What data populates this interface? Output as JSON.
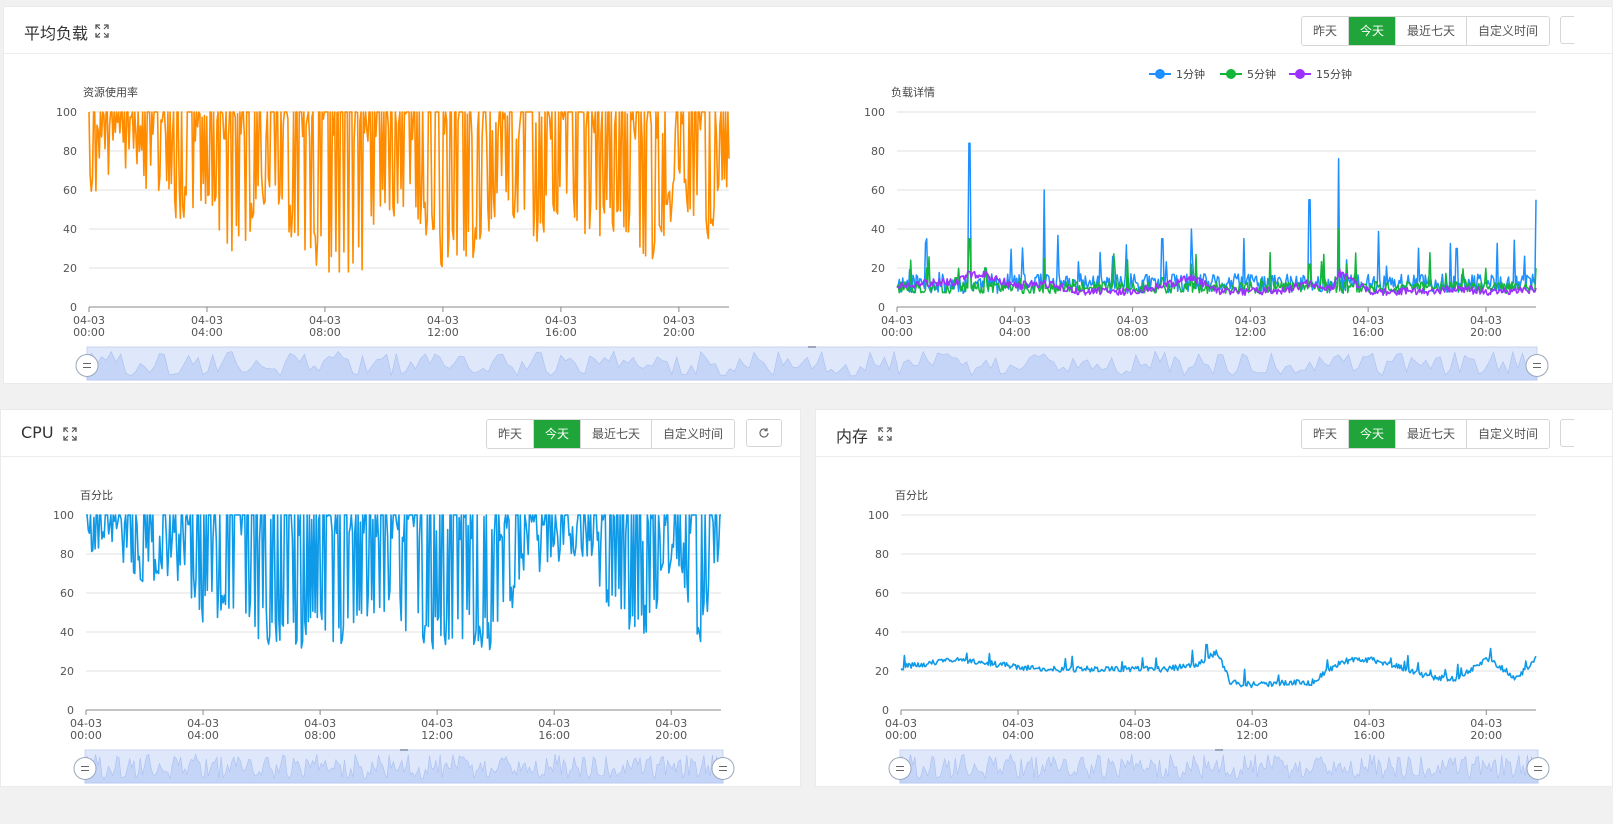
{
  "load_panel": {
    "title": "平均负载",
    "buttons": [
      "昨天",
      "今天",
      "最近七天",
      "自定义时间"
    ],
    "active_button": "今天",
    "left_chart_ylabel": "资源使用率",
    "right_chart_ylabel": "负载详情",
    "legend": [
      "1分钟",
      "5分钟",
      "15分钟"
    ]
  },
  "cpu_panel": {
    "title": "CPU",
    "buttons": [
      "昨天",
      "今天",
      "最近七天",
      "自定义时间"
    ],
    "active_button": "今天",
    "ylabel": "百分比"
  },
  "memory_panel": {
    "title": "内存",
    "buttons": [
      "昨天",
      "今天",
      "最近七天",
      "自定义时间"
    ],
    "active_button": "今天",
    "ylabel": "百分比"
  },
  "colors": {
    "accent_green": "#20a53a",
    "load_usage": "#ff8c00",
    "load_1min": "#1e90ff",
    "load_5min": "#13b53b",
    "load_15min": "#9b30ff",
    "cpu": "#0f9ae8",
    "memory": "#0f9ae8",
    "zoom_fill": "#d4e0fb"
  },
  "icons": {
    "expand": "expand-arrows-icon",
    "refresh": "refresh-icon",
    "zoom_handle": "zoom-handle-icon"
  },
  "chart_data": [
    {
      "id": "load_usage",
      "type": "line",
      "ylabel": "资源使用率",
      "ylim": [
        0,
        100
      ],
      "yticks": [
        0,
        20,
        40,
        60,
        80,
        100
      ],
      "xticks": [
        "04-03\n00:00",
        "04-03\n04:00",
        "04-03\n08:00",
        "04-03\n12:00",
        "04-03\n16:00",
        "04-03\n20:00"
      ],
      "x_hours": [
        0,
        1,
        2,
        3,
        4,
        5,
        6,
        7,
        8,
        9,
        10,
        11,
        12,
        13,
        14,
        15,
        16,
        17,
        18,
        19,
        20,
        21,
        21.7
      ],
      "series": [
        {
          "values": [
            65,
            85,
            70,
            55,
            60,
            35,
            65,
            40,
            28,
            20,
            55,
            60,
            30,
            35,
            60,
            40,
            60,
            45,
            50,
            25,
            65,
            45,
            75
          ]
        }
      ]
    },
    {
      "id": "load_detail",
      "type": "line",
      "ylabel": "负载详情",
      "ylim": [
        0,
        100
      ],
      "yticks": [
        0,
        20,
        40,
        60,
        80,
        100
      ],
      "xticks": [
        "04-03\n00:00",
        "04-03\n04:00",
        "04-03\n08:00",
        "04-03\n12:00",
        "04-03\n16:00",
        "04-03\n20:00"
      ],
      "x_hours": [
        0,
        1,
        2,
        2.45,
        3,
        4,
        5,
        5.8,
        6,
        7,
        8,
        9,
        10,
        11,
        12,
        13,
        14,
        14.8,
        15,
        16,
        17,
        18,
        19,
        20,
        21,
        21.7
      ],
      "legend_position": "top-center",
      "series": [
        {
          "name": "1分钟",
          "values": [
            10,
            35,
            15,
            84,
            20,
            12,
            60,
            10,
            10,
            8,
            10,
            35,
            40,
            10,
            10,
            10,
            55,
            10,
            76,
            8,
            10,
            12,
            30,
            8,
            10,
            55
          ]
        },
        {
          "name": "5分钟",
          "values": [
            10,
            20,
            15,
            35,
            20,
            12,
            25,
            10,
            10,
            8,
            10,
            15,
            22,
            10,
            10,
            10,
            22,
            10,
            40,
            8,
            10,
            10,
            12,
            8,
            10,
            20
          ]
        },
        {
          "name": "15分钟",
          "values": [
            12,
            14,
            15,
            20,
            20,
            12,
            14,
            10,
            8,
            8,
            8,
            12,
            18,
            8,
            8,
            8,
            14,
            10,
            22,
            8,
            8,
            8,
            10,
            8,
            8,
            10
          ]
        }
      ]
    },
    {
      "id": "cpu",
      "type": "line",
      "ylabel": "百分比",
      "ylim": [
        0,
        100
      ],
      "yticks": [
        0,
        20,
        40,
        60,
        80,
        100
      ],
      "xticks": [
        "04-03\n00:00",
        "04-03\n04:00",
        "04-03\n08:00",
        "04-03\n12:00",
        "04-03\n16:00",
        "04-03\n20:00"
      ],
      "x_hours": [
        0,
        1,
        2,
        3,
        4,
        5,
        6,
        7,
        8,
        9,
        10,
        11,
        12,
        13,
        14,
        15,
        16,
        17,
        18,
        19,
        20,
        21,
        21.7
      ],
      "series": [
        {
          "values": [
            85,
            90,
            75,
            80,
            55,
            60,
            45,
            40,
            45,
            40,
            60,
            50,
            40,
            45,
            40,
            75,
            80,
            85,
            60,
            45,
            80,
            45,
            80
          ]
        }
      ]
    },
    {
      "id": "memory",
      "type": "line",
      "ylabel": "百分比",
      "ylim": [
        0,
        100
      ],
      "yticks": [
        0,
        20,
        40,
        60,
        80,
        100
      ],
      "xticks": [
        "04-03\n00:00",
        "04-03\n04:00",
        "04-03\n08:00",
        "04-03\n12:00",
        "04-03\n16:00",
        "04-03\n20:00"
      ],
      "x_hours": [
        0,
        1,
        2,
        3,
        4,
        5,
        6,
        7,
        8,
        9,
        10,
        10.8,
        11.2,
        12,
        13,
        14,
        15,
        16,
        17,
        18,
        19,
        20,
        21,
        21.7
      ],
      "series": [
        {
          "values": [
            22,
            24,
            26,
            24,
            22,
            21,
            21,
            21,
            21,
            21,
            23,
            30,
            14,
            13,
            14,
            14,
            25,
            26,
            22,
            17,
            16,
            27,
            16,
            27
          ]
        }
      ]
    }
  ]
}
